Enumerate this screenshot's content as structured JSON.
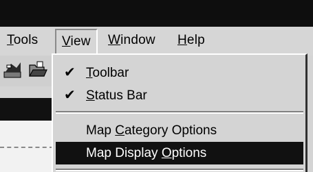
{
  "menubar": {
    "items": [
      {
        "label_pre": "",
        "label_ul": "T",
        "label_post": "ools"
      },
      {
        "label_pre": "",
        "label_ul": "V",
        "label_post": "iew"
      },
      {
        "label_pre": "",
        "label_ul": "W",
        "label_post": "indow"
      },
      {
        "label_pre": "",
        "label_ul": "H",
        "label_post": "elp"
      }
    ]
  },
  "view_menu": {
    "items": [
      {
        "check": "✔",
        "pre": "",
        "ul": "T",
        "post": "oolbar",
        "checked": true
      },
      {
        "check": "✔",
        "pre": "",
        "ul": "S",
        "post": "tatus Bar",
        "checked": true
      },
      {
        "check": "",
        "pre": "Map ",
        "ul": "C",
        "post": "ategory Options",
        "checked": false
      },
      {
        "check": "",
        "pre": "Map Display ",
        "ul": "O",
        "post": "ptions",
        "checked": false,
        "highlighted": true
      }
    ]
  },
  "colors": {
    "highlight_bg": "#111111",
    "menu_bg": "#d4d4d4",
    "titlebar": "#0e0e0e"
  }
}
